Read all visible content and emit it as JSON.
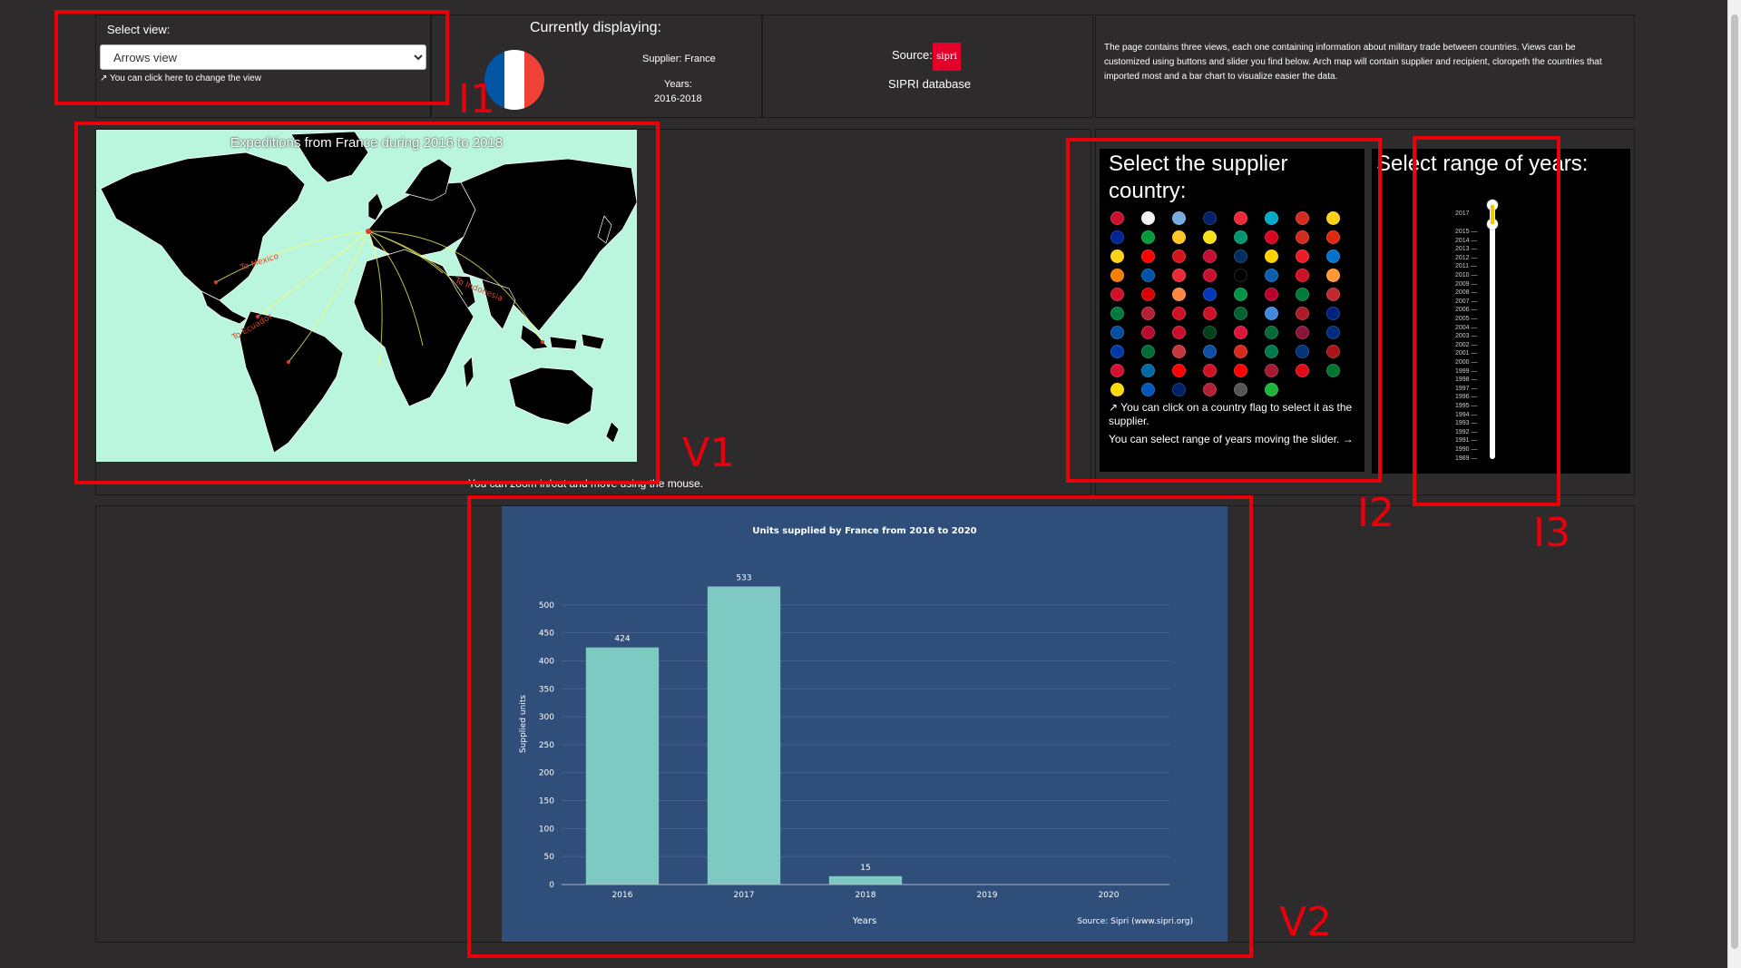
{
  "selector": {
    "label": "Select view:",
    "selected": "Arrows view",
    "options": [
      "Arrows view"
    ],
    "hint": "↗ You can click here to change the view"
  },
  "display": {
    "title": "Currently displaying:",
    "supplier": "Supplier: France",
    "years_label": "Years:",
    "years_value": "2016-2018"
  },
  "source": {
    "label": "Source:",
    "logo_text": "sipri",
    "name": "SIPRI database"
  },
  "description": "The page contains three views, each one containing information about military trade between countries. Views can be customized using buttons and slider you find below. Arch map will contain supplier and recipient, cloropeth the countries that imported most and a bar chart to visualize easier the data.",
  "map": {
    "title": "Expeditions from France during 2016 to 2018",
    "route_labels": [
      "To Mexico",
      "To Ecuador",
      "To Indonesia"
    ],
    "zoom_hint": "You can zoom in/out and move using the mouse."
  },
  "supplier_panel": {
    "title": "Select the supplier country:",
    "hint": "↗ You can click on a country flag to select it as the supplier.",
    "range_hint": "You can select range of years moving the slider. →",
    "flag_colors": [
      "#c8102e",
      "#f5f5f5",
      "#74acdf",
      "#012169",
      "#ed2939",
      "#00abc9",
      "#d52b1e",
      "#fcd116",
      "#002395",
      "#009c3b",
      "#ffc726",
      "#f7e017",
      "#00966e",
      "#d80621",
      "#d52b1e",
      "#de2910",
      "#fcd116",
      "#ff0000",
      "#d7141a",
      "#c60c30",
      "#002d62",
      "#ffd100",
      "#ed1c24",
      "#0072ce",
      "#f77f00",
      "#0053a5",
      "#ed2939",
      "#c8102e",
      "#000000",
      "#0d5eaf",
      "#ce1126",
      "#ff9933",
      "#ce1126",
      "#da0000",
      "#ff883e",
      "#0038b8",
      "#009246",
      "#bc002d",
      "#007a3d",
      "#c1272d",
      "#007a3d",
      "#b22234",
      "#ce1126",
      "#ce1126",
      "#006233",
      "#4189dd",
      "#ae1c28",
      "#00247d",
      "#024fa2",
      "#ba0c2f",
      "#c8102e",
      "#01411c",
      "#dc143c",
      "#046a38",
      "#8a1538",
      "#002b7f",
      "#0039a6",
      "#006c35",
      "#c6363c",
      "#0b4ea2",
      "#d52b1e",
      "#007a4d",
      "#003478",
      "#aa151b",
      "#d21034",
      "#006aa7",
      "#ff0000",
      "#ce1126",
      "#fe0000",
      "#a51931",
      "#e30a17",
      "#00732f",
      "#fcdc04",
      "#0057b7",
      "#012169",
      "#b22234",
      "#555555",
      "#1eb53a"
    ]
  },
  "years_panel": {
    "title": "Select range of years:",
    "slider_top_label": "2017",
    "ticks": [
      "2015",
      "2014",
      "2013",
      "2012",
      "2011",
      "2010",
      "2009",
      "2008",
      "2007",
      "2006",
      "2005",
      "2004",
      "2003",
      "2002",
      "2001",
      "2000",
      "1999",
      "1998",
      "1997",
      "1996",
      "1995",
      "1994",
      "1993",
      "1992",
      "1991",
      "1990",
      "1989"
    ]
  },
  "chart_data": {
    "type": "bar",
    "title": "Units supplied by France from 2016 to 2020",
    "xlabel": "Years",
    "ylabel": "Supplied units",
    "categories": [
      "2016",
      "2017",
      "2018",
      "2019",
      "2020"
    ],
    "values": [
      424,
      533,
      15,
      0,
      0
    ],
    "data_labels": [
      "424",
      "533",
      "15",
      "",
      ""
    ],
    "yticks": [
      0,
      50,
      100,
      150,
      200,
      250,
      300,
      350,
      400,
      450,
      500
    ],
    "ylim": [
      0,
      550
    ],
    "credits": "Source: Sipri (www.sipri.org)",
    "colors": {
      "bar": "#7ecac3",
      "background": "#2f4e7a",
      "grid": "#4a6690",
      "text": "#ffffff"
    }
  },
  "annotations": {
    "i1": "I1",
    "v1": "V1",
    "i2": "I2",
    "i3": "I3",
    "v2": "V2"
  }
}
